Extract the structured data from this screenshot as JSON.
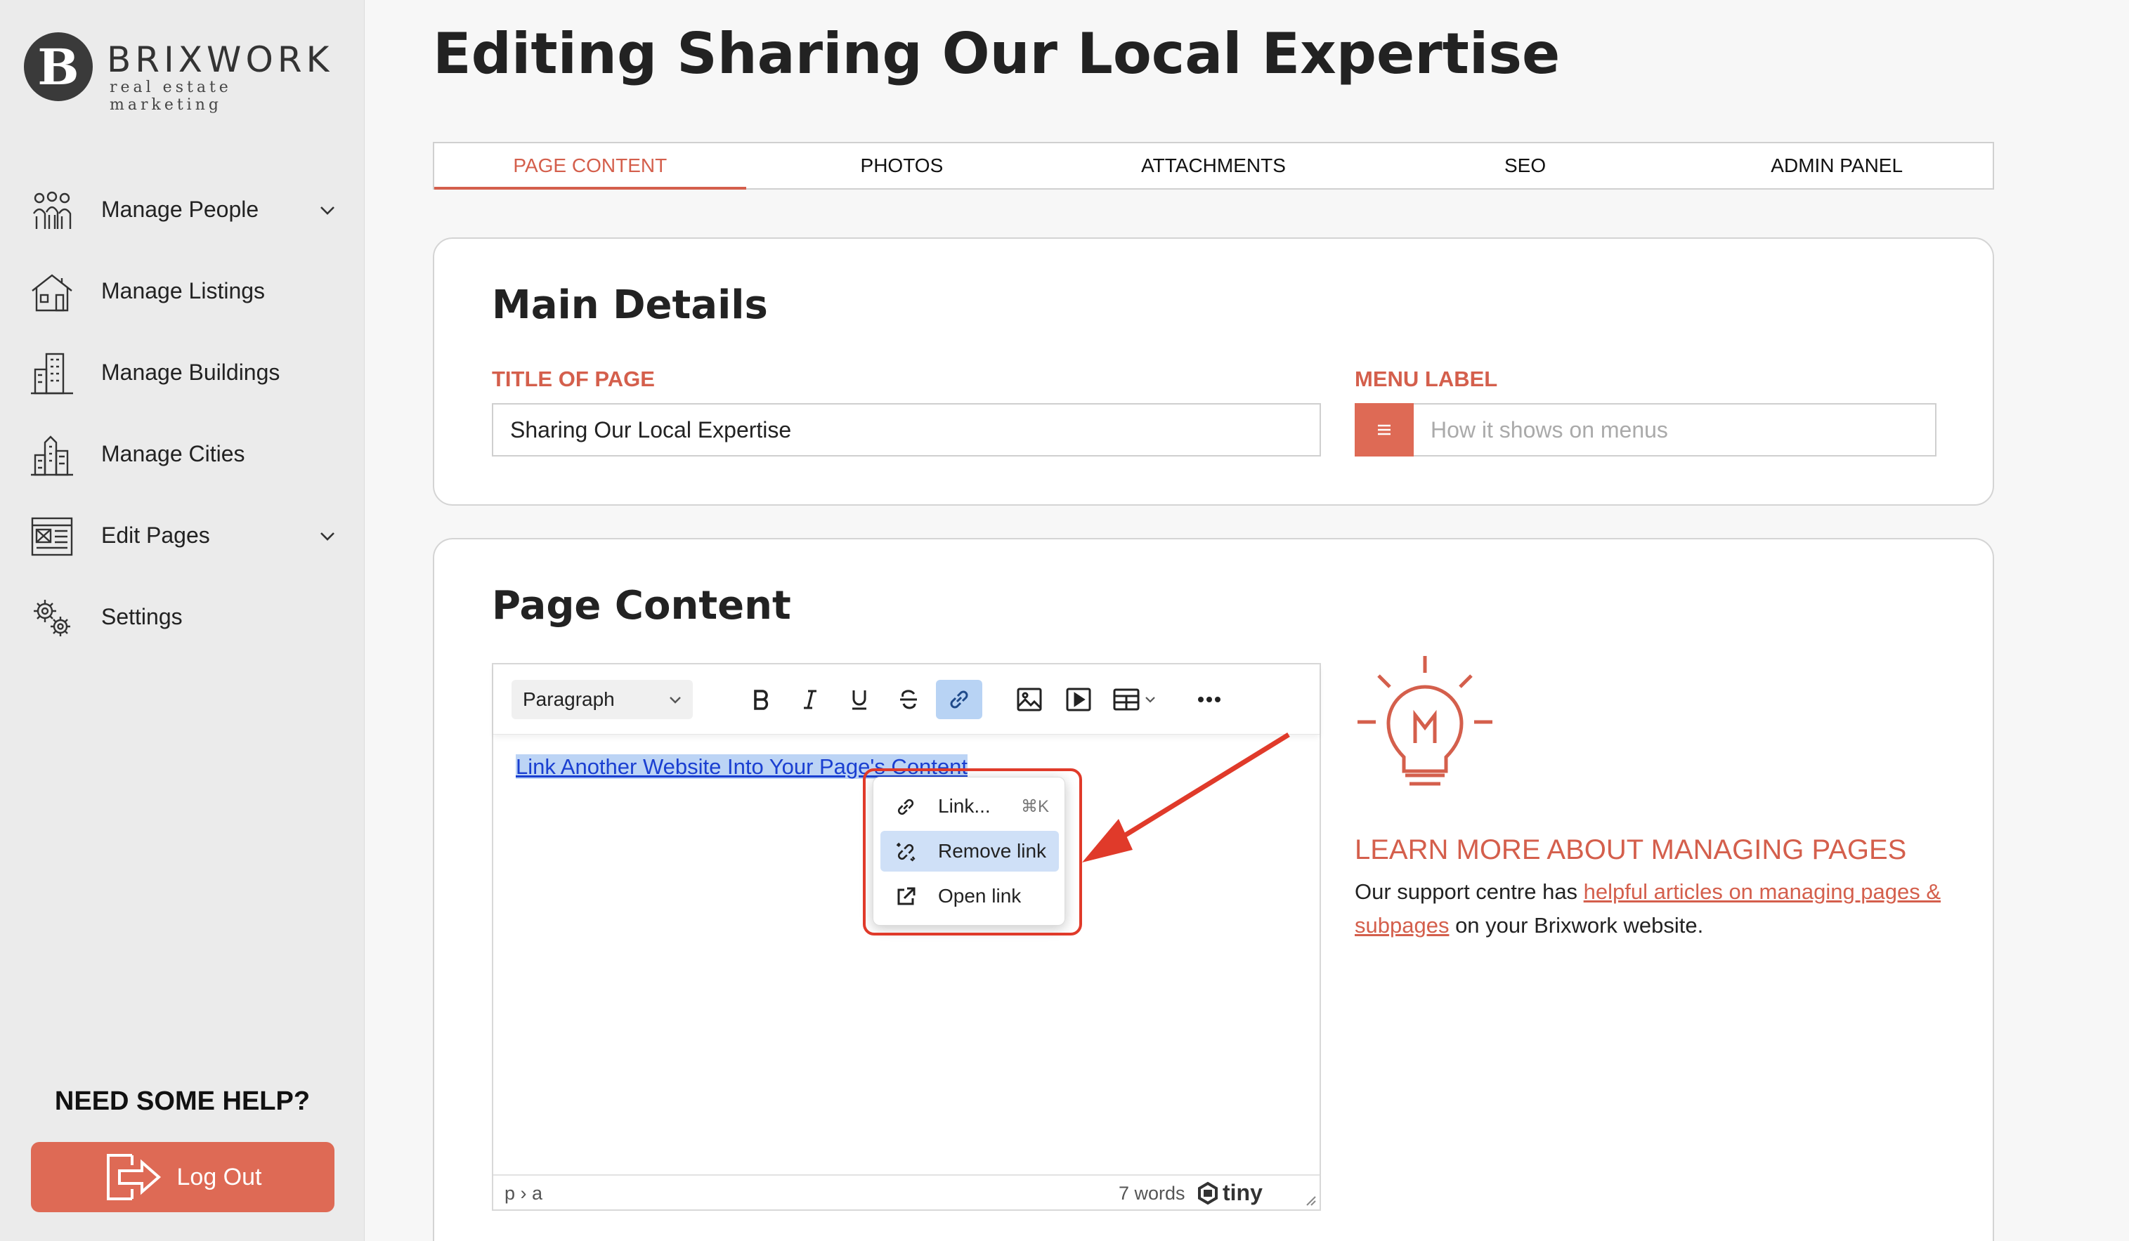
{
  "brand": {
    "letter": "B",
    "name": "BRIXWORK",
    "tagline": "real estate marketing"
  },
  "sidebar": {
    "items": [
      {
        "label": "Manage People",
        "icon": "people-icon",
        "has_submenu": true
      },
      {
        "label": "Manage Listings",
        "icon": "house-icon",
        "has_submenu": false
      },
      {
        "label": "Manage Buildings",
        "icon": "building-icon",
        "has_submenu": false
      },
      {
        "label": "Manage Cities",
        "icon": "city-icon",
        "has_submenu": false
      },
      {
        "label": "Edit Pages",
        "icon": "page-icon",
        "has_submenu": true
      },
      {
        "label": "Settings",
        "icon": "gears-icon",
        "has_submenu": false
      }
    ],
    "help_title": "NEED SOME HELP?",
    "logout_label": "Log Out"
  },
  "page": {
    "title": "Editing Sharing Our Local Expertise"
  },
  "tabs": [
    {
      "label": "PAGE CONTENT",
      "active": true
    },
    {
      "label": "PHOTOS",
      "active": false
    },
    {
      "label": "ATTACHMENTS",
      "active": false
    },
    {
      "label": "SEO",
      "active": false
    },
    {
      "label": "ADMIN PANEL",
      "active": false
    }
  ],
  "main_details": {
    "title": "Main Details",
    "title_of_page_label": "TITLE OF PAGE",
    "title_of_page_value": "Sharing Our Local Expertise",
    "menu_label_label": "MENU LABEL",
    "menu_label_placeholder": "How it shows on menus",
    "menu_label_value": ""
  },
  "page_content": {
    "title": "Page Content",
    "editor": {
      "block_format": "Paragraph",
      "body_link_text": "Link Another Website Into Your Page's Content",
      "status_path": "p › a",
      "word_count": "7 words",
      "brand": "tiny",
      "context_menu": [
        {
          "label": "Link...",
          "shortcut": "⌘K",
          "icon": "link-icon",
          "highlighted": false
        },
        {
          "label": "Remove link",
          "shortcut": "",
          "icon": "unlink-icon",
          "highlighted": true
        },
        {
          "label": "Open link",
          "shortcut": "",
          "icon": "external-link-icon",
          "highlighted": false
        }
      ]
    },
    "learn_more": {
      "title": "LEARN MORE ABOUT MANAGING PAGES",
      "text_before": "Our support centre has ",
      "link_text": "helpful articles on managing pages & subpages",
      "text_after": " on your Brixwork website."
    }
  },
  "colors": {
    "accent": "#de6a55",
    "accent_text": "#d45f4c",
    "sidebar_bg": "#ebebeb",
    "annotation_red": "#e03a2a",
    "link_blue": "#1a3fd1"
  }
}
